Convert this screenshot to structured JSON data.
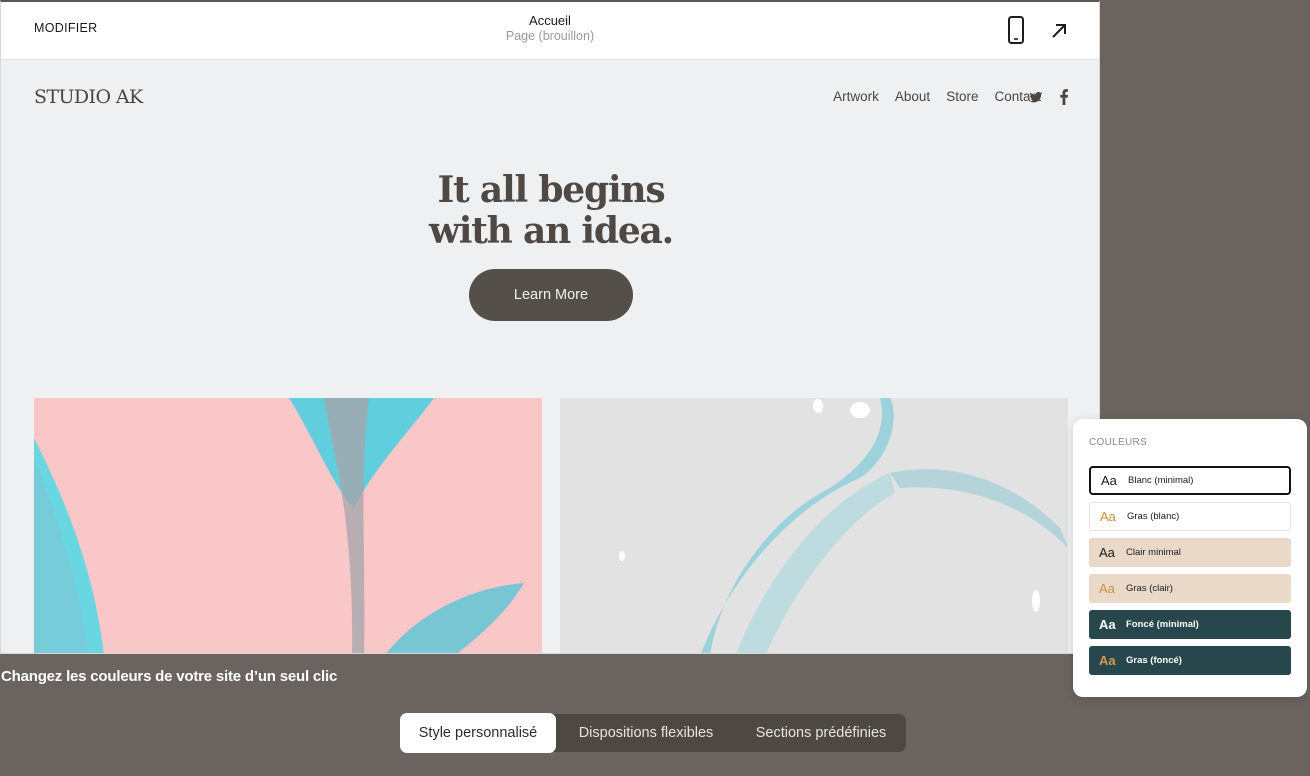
{
  "editor": {
    "edit_label": "MODIFIER",
    "page_title": "Accueil",
    "page_status": "Page (brouillon)",
    "icons": {
      "mobile": "mobile-phone-icon",
      "open": "arrow-up-right-icon"
    }
  },
  "site": {
    "logo": "STUDIO AK",
    "nav": [
      "Artwork",
      "About",
      "Store",
      "Contact"
    ],
    "social": [
      "twitter-icon",
      "facebook-icon"
    ],
    "hero_line1": "It all begins",
    "hero_line2": "with an idea.",
    "cta_label": "Learn More"
  },
  "caption": "Changez les couleurs de votre site d’un seul clic",
  "tabs": [
    "Style personnalisé",
    "Dispositions flexibles",
    "Sections prédéfinies"
  ],
  "active_tab": "Style personnalisé",
  "colors_panel": {
    "title": "COULEURS",
    "aa": "Aa",
    "options": [
      {
        "label": "Blanc (minimal)",
        "bg": "#ffffff",
        "fg": "#1a1a1a",
        "aa_color": "#1a1a1a",
        "selected": true
      },
      {
        "label": "Gras (blanc)",
        "bg": "#ffffff",
        "fg": "#1a1a1a",
        "aa_color": "#c9913a",
        "selected": false
      },
      {
        "label": "Clair minimal",
        "bg": "#ead9c8",
        "fg": "#1a1a1a",
        "aa_color": "#1a1a1a",
        "selected": false
      },
      {
        "label": "Gras (clair)",
        "bg": "#ead9c8",
        "fg": "#1a1a1a",
        "aa_color": "#c9913a",
        "selected": false
      },
      {
        "label": "Foncé (minimal)",
        "bg": "#27474c",
        "fg": "#ffffff",
        "aa_color": "#ffffff",
        "selected": false
      },
      {
        "label": "Gras (foncé)",
        "bg": "#27474c",
        "fg": "#ffffff",
        "aa_color": "#d79b4a",
        "selected": false
      }
    ]
  },
  "colors": {
    "page_bg": "#6a6360",
    "button": "#554f4a",
    "pink": "#f9c7c8",
    "teal": "#3fd3e0"
  }
}
